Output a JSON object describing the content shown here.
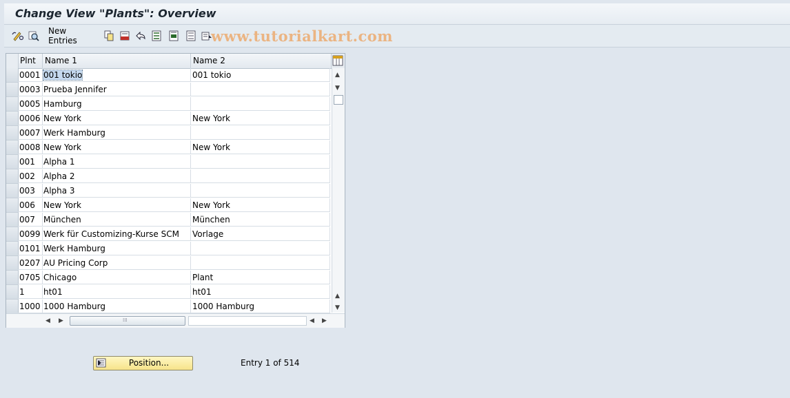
{
  "window": {
    "title": "Change View \"Plants\": Overview"
  },
  "toolbar": {
    "new_entries_label": "New Entries",
    "icons": [
      "display-change-icon",
      "details-icon",
      "copy-icon",
      "delete-icon",
      "undo-icon",
      "select-all-icon",
      "select-block-icon",
      "deselect-all-icon",
      "print-icon"
    ]
  },
  "watermark": "www.tutorialkart.com",
  "table": {
    "columns": [
      "Plnt",
      "Name 1",
      "Name 2"
    ],
    "rows": [
      {
        "plnt": "0001",
        "name1": "001 tokio",
        "name2": "001 tokio"
      },
      {
        "plnt": "0003",
        "name1": "Prueba Jennifer",
        "name2": ""
      },
      {
        "plnt": "0005",
        "name1": "Hamburg",
        "name2": ""
      },
      {
        "plnt": "0006",
        "name1": "New York",
        "name2": "New York"
      },
      {
        "plnt": "0007",
        "name1": "Werk Hamburg",
        "name2": ""
      },
      {
        "plnt": "0008",
        "name1": "New York",
        "name2": "New York"
      },
      {
        "plnt": "001",
        "name1": "Alpha 1",
        "name2": ""
      },
      {
        "plnt": "002",
        "name1": "Alpha 2",
        "name2": ""
      },
      {
        "plnt": "003",
        "name1": "Alpha 3",
        "name2": ""
      },
      {
        "plnt": "006",
        "name1": "New York",
        "name2": "New York"
      },
      {
        "plnt": "007",
        "name1": "München",
        "name2": "München"
      },
      {
        "plnt": "0099",
        "name1": "Werk für Customizing-Kurse SCM",
        "name2": "Vorlage"
      },
      {
        "plnt": "0101",
        "name1": "Werk Hamburg",
        "name2": ""
      },
      {
        "plnt": "0207",
        "name1": "AU Pricing Corp",
        "name2": ""
      },
      {
        "plnt": "0705",
        "name1": "Chicago",
        "name2": "Plant"
      },
      {
        "plnt": "1",
        "name1": "ht01",
        "name2": "ht01"
      },
      {
        "plnt": "1000",
        "name1": "1000 Hamburg",
        "name2": "1000 Hamburg"
      }
    ]
  },
  "footer": {
    "position_label": "Position...",
    "entry_text": "Entry 1 of 514"
  },
  "colors": {
    "background": "#dfe6ee",
    "button_yellow": "#f6e38a",
    "selection": "#c5d9ef"
  }
}
